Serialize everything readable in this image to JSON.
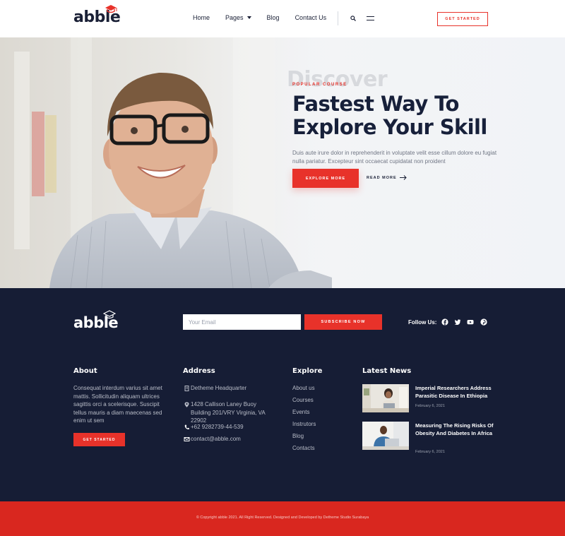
{
  "header": {
    "logo": "abble",
    "nav": [
      {
        "label": "Home"
      },
      {
        "label": "Pages"
      },
      {
        "label": "Blog"
      },
      {
        "label": "Contact Us"
      }
    ],
    "cta": "GET STARTED"
  },
  "hero": {
    "watermark": "Discover",
    "eyebrow": "POPULAR COURSE",
    "title_line1": "Fastest Way To",
    "title_line2": "Explore Your Skill",
    "description": "Duis aute irure dolor in reprehenderit in voluptate velit esse cillum dolore eu fugiat nulla pariatur. Excepteur sint occaecat cupidatat non proident",
    "primary_button": "EXPLORE MORE",
    "secondary_link": "READ MORE"
  },
  "footer": {
    "logo": "abble",
    "email_placeholder": "Your Email",
    "subscribe_button": "SUBSCRIBE NOW",
    "follow_label": "Follow Us:",
    "social_icons": [
      "facebook-icon",
      "twitter-icon",
      "youtube-icon",
      "pinterest-icon"
    ],
    "about": {
      "title": "About",
      "text": "Consequat interdum varius sit amet mattis. Sollicitudin aliquam ultrices sagittis orci a scelerisque. Suscipit tellus mauris a diam maecenas sed enim ut sem",
      "button": "GET STARTED"
    },
    "address": {
      "title": "Address",
      "headquarter": "Detheme Headquarter",
      "street": "1428 Callison Laney Buoy Building 201/VRY Virginia, VA 22902",
      "phone": "+62 9282739-44-539",
      "email": "contact@abble.com"
    },
    "explore": {
      "title": "Explore",
      "links": [
        "About us",
        "Courses",
        "Events",
        "Instrutors",
        "Blog",
        "Contacts"
      ]
    },
    "news": {
      "title": "Latest News",
      "items": [
        {
          "title": "Imperial Researchers Address Parasitic Disease In Ethiopia",
          "date": "February 6, 2021"
        },
        {
          "title": "Measuring The Rising Risks Of Obesity And Diabetes In Africa",
          "date": "February 6, 2021"
        }
      ]
    }
  },
  "bottom": {
    "copyright": "© Copyright abble 2021. All Right Reserved. Designed and Developed by Detheme Studio Surabaya"
  },
  "colors": {
    "accent": "#e8322a",
    "navy": "#161d35",
    "bottom_bar": "#d9271f"
  }
}
